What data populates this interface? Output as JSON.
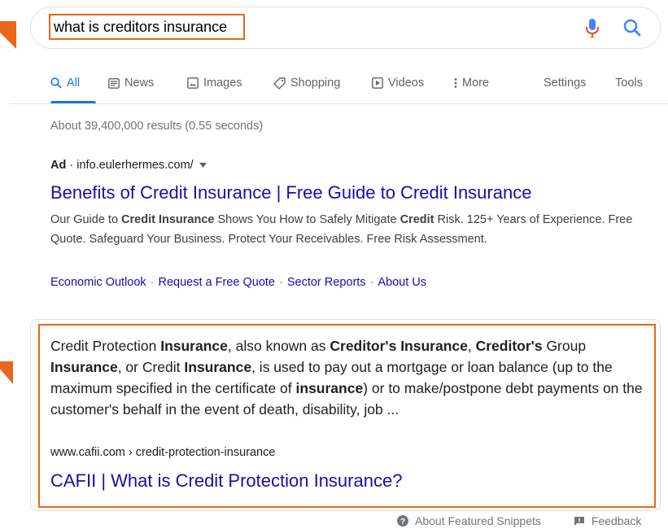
{
  "search": {
    "query": "what is creditors insurance"
  },
  "tabs": [
    {
      "label": "All",
      "icon": "search-icon"
    },
    {
      "label": "News",
      "icon": "news-icon"
    },
    {
      "label": "Images",
      "icon": "image-icon"
    },
    {
      "label": "Shopping",
      "icon": "tag-icon"
    },
    {
      "label": "Videos",
      "icon": "play-icon"
    },
    {
      "label": "More",
      "icon": "more-vert-icon"
    }
  ],
  "tools": {
    "settings_label": "Settings",
    "tools_label": "Tools"
  },
  "result_stats": "About 39,400,000 results (0.55 seconds)",
  "ad": {
    "badge": "Ad",
    "dot": "·",
    "url": "info.eulerhermes.com/",
    "title": "Benefits of Credit Insurance | Free Guide to Credit Insurance",
    "desc_1": "Our Guide to ",
    "desc_2": "Credit Insurance",
    "desc_3": " Shows You How to Safely Mitigate ",
    "desc_4": "Credit",
    "desc_5": " Risk. 125+ Years of Experience. Free Quote. Safeguard Your Business. Protect Your Receivables. Free Risk Assessment.",
    "sitelinks": [
      "Economic Outlook",
      "Request a Free Quote",
      "Sector Reports",
      "About Us"
    ],
    "sitelink_sep": "·"
  },
  "snippet": {
    "parts": [
      {
        "t": "Credit Protection ",
        "b": false
      },
      {
        "t": "Insurance",
        "b": true
      },
      {
        "t": ", also known as ",
        "b": false
      },
      {
        "t": "Creditor's Insurance",
        "b": true
      },
      {
        "t": ", ",
        "b": false
      },
      {
        "t": "Creditor's",
        "b": true
      },
      {
        "t": " Group ",
        "b": false
      },
      {
        "t": "Insurance",
        "b": true
      },
      {
        "t": ", or Credit ",
        "b": false
      },
      {
        "t": "Insurance",
        "b": true
      },
      {
        "t": ", is used to pay out a mortgage or loan balance (up to the maximum specified in the certificate of ",
        "b": false
      },
      {
        "t": "insurance",
        "b": true
      },
      {
        "t": ") or to make/postpone debt payments on the customer's behalf in the event of death, disability, job ...",
        "b": false
      }
    ],
    "url": "www.cafii.com › credit-protection-insurance",
    "title": "CAFII | What is Credit Protection Insurance?"
  },
  "footer": {
    "about_label": "About Featured Snippets",
    "feedback_label": "Feedback"
  },
  "colors": {
    "highlight": "#e8671c",
    "link": "#1a0dab",
    "accent": "#1a73e8"
  }
}
